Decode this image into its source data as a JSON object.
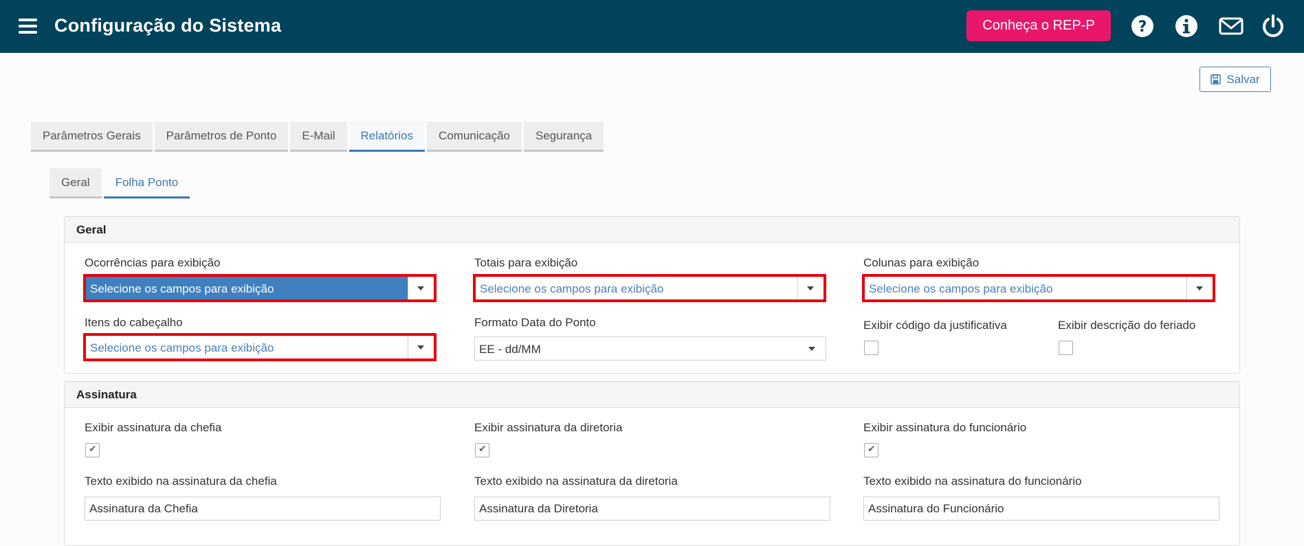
{
  "header": {
    "title": "Configuração do Sistema",
    "rep_button": "Conheça o REP-P",
    "icons": [
      "menu-icon",
      "help-icon",
      "info-icon",
      "mail-icon",
      "power-icon"
    ]
  },
  "toolbar": {
    "save_label": "Salvar"
  },
  "tabs": [
    {
      "label": "Parâmetros Gerais"
    },
    {
      "label": "Parâmetros de Ponto"
    },
    {
      "label": "E-Mail"
    },
    {
      "label": "Relatórios"
    },
    {
      "label": "Comunicação"
    },
    {
      "label": "Segurança"
    }
  ],
  "active_tab": "Relatórios",
  "subtabs": [
    {
      "label": "Geral"
    },
    {
      "label": "Folha Ponto"
    }
  ],
  "active_subtab": "Folha Ponto",
  "geral": {
    "heading": "Geral",
    "ocorrencias": {
      "label": "Ocorrências para exibição",
      "placeholder": "Selecione os campos para exibição"
    },
    "totais": {
      "label": "Totais para exibição",
      "placeholder": "Selecione os campos para exibição"
    },
    "colunas": {
      "label": "Colunas para exibição",
      "placeholder": "Selecione os campos para exibição"
    },
    "cabecalho": {
      "label": "Itens do cabeçalho",
      "placeholder": "Selecione os campos para exibição"
    },
    "formato_data": {
      "label": "Formato Data do Ponto",
      "value": "EE - dd/MM"
    },
    "exibir_codigo": {
      "label": "Exibir código da justificativa",
      "checked": false
    },
    "exibir_feriado": {
      "label": "Exibir descrição do feriado",
      "checked": false
    }
  },
  "assinatura": {
    "heading": "Assinatura",
    "chefia": {
      "label": "Exibir assinatura da chefia",
      "checked": true
    },
    "diretoria": {
      "label": "Exibir assinatura da diretoria",
      "checked": true
    },
    "funcionario": {
      "label": "Exibir assinatura do funcionário",
      "checked": true
    },
    "texto_chefia": {
      "label": "Texto exibido na assinatura da chefia",
      "value": "Assinatura da Chefia"
    },
    "texto_diretoria": {
      "label": "Texto exibido na assinatura da diretoria",
      "value": "Assinatura da Diretoria"
    },
    "texto_funcionario": {
      "label": "Texto exibido na assinatura do funcionário",
      "value": "Assinatura do Funcionário"
    }
  },
  "colors": {
    "header_bg": "#00435b",
    "accent_pink": "#e8176b",
    "link_blue": "#3c78b4",
    "highlight_red": "#e8000d"
  }
}
